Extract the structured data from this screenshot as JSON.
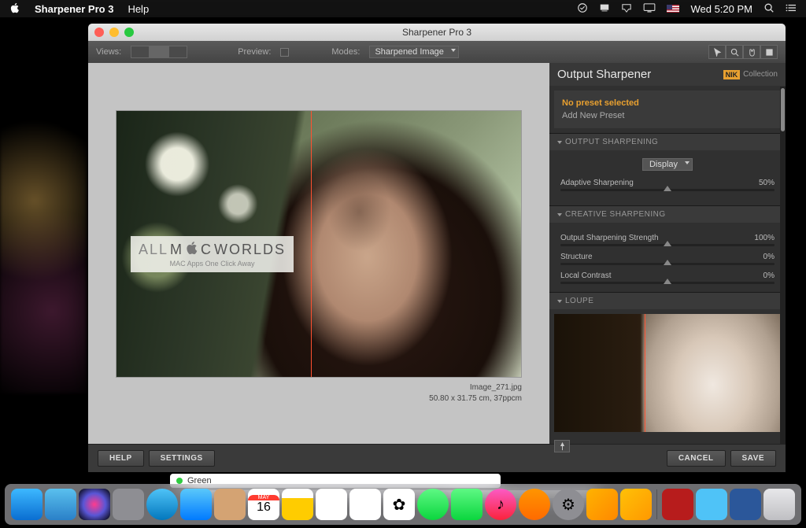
{
  "menubar": {
    "app_name": "Sharpener Pro 3",
    "help": "Help",
    "clock": "Wed 5:20 PM"
  },
  "window": {
    "title": "Sharpener Pro 3"
  },
  "toolbar": {
    "views_label": "Views:",
    "preview_label": "Preview:",
    "modes_label": "Modes:",
    "mode_selected": "Sharpened Image"
  },
  "watermark": {
    "text_all": "ALL",
    "text_m": "M",
    "text_c": "C",
    "text_worlds": "WORLDS",
    "sub": "MAC Apps One Click Away"
  },
  "image_meta": {
    "filename": "Image_271.jpg",
    "dims": "50.80 x 31.75 cm, 37ppcm"
  },
  "panel": {
    "title": "Output Sharpener",
    "brand_label": "Collection",
    "brand_nik": "NIK",
    "preset_none": "No preset selected",
    "preset_add": "Add New Preset",
    "section_output": "OUTPUT SHARPENING",
    "output_mode": "Display",
    "adaptive_label": "Adaptive Sharpening",
    "adaptive_value": "50%",
    "section_creative": "CREATIVE SHARPENING",
    "strength_label": "Output Sharpening Strength",
    "strength_value": "100%",
    "structure_label": "Structure",
    "structure_value": "0%",
    "contrast_label": "Local Contrast",
    "contrast_value": "0%",
    "section_loupe": "LOUPE"
  },
  "buttons": {
    "help": "HELP",
    "settings": "SETTINGS",
    "cancel": "CANCEL",
    "save": "SAVE"
  },
  "finder": {
    "tag": "Green"
  },
  "calendar": {
    "month": "MAY",
    "day": "16"
  }
}
